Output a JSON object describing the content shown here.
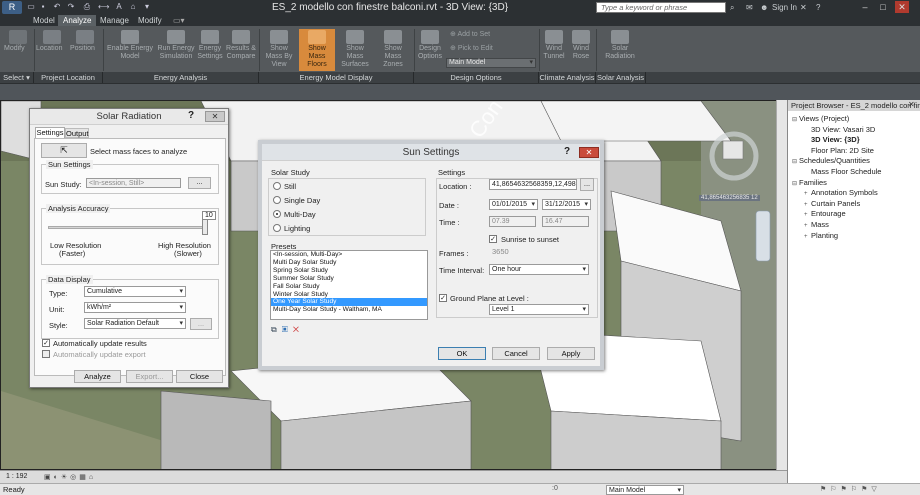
{
  "app": {
    "title": "ES_2 modello con finestre balconi.rvt - 3D View: {3D}",
    "search_placeholder": "Type a keyword or phrase",
    "sign_in": "Sign In",
    "app_button": "R"
  },
  "tabs": [
    "Model",
    "Analyze",
    "Manage",
    "Modify"
  ],
  "ribbon": {
    "buttons": [
      {
        "label": "Modify"
      },
      {
        "label": "Location"
      },
      {
        "label": "Position"
      },
      {
        "label": "Enable Energy Model"
      },
      {
        "label": "Run Energy Simulation"
      },
      {
        "label": "Energy Settings"
      },
      {
        "label": "Results & Compare"
      },
      {
        "label": "Show Mass By View"
      },
      {
        "label": "Show Mass Floors"
      },
      {
        "label": "Show Mass Surfaces"
      },
      {
        "label": "Show Mass Zones"
      },
      {
        "label": "Design Options"
      },
      {
        "label": "Wind Tunnel"
      },
      {
        "label": "Wind Rose"
      },
      {
        "label": "Solar Radiation"
      }
    ],
    "small": {
      "add_to_set": "Add to Set",
      "pick_to_edit": "Pick to Edit",
      "main_model": "Main Model"
    },
    "groups": [
      "Select ▾",
      "Project Location",
      "Energy Analysis",
      "Energy Model Display",
      "Design Options",
      "Climate Analysis",
      "Solar Analysis"
    ]
  },
  "solar_radiation": {
    "title": "Solar Radiation",
    "tabs": [
      "Settings",
      "Output"
    ],
    "select_text": "Select mass faces to analyze",
    "sun_settings": {
      "group": "Sun Settings",
      "label": "Sun Study:",
      "value": "<In-session, Still>",
      "browse": "..."
    },
    "accuracy": {
      "group": "Analysis Accuracy",
      "value": "10",
      "low": "Low Resolution",
      "low_sub": "(Faster)",
      "high": "High Resolution",
      "high_sub": "(Slower)",
      "fraction": 1.0
    },
    "display": {
      "group": "Data Display",
      "type_label": "Type:",
      "type_value": "Cumulative",
      "unit_label": "Unit:",
      "unit_value": "kWh/m²",
      "style_label": "Style:",
      "style_value": "Solar Radiation Default",
      "style_btn": "..."
    },
    "auto_update": "Automatically update results",
    "auto_export": "Automatically update export",
    "buttons": {
      "analyze": "Analyze",
      "export": "Export...",
      "close": "Close"
    }
  },
  "sun_settings": {
    "title": "Sun Settings",
    "solar_study": {
      "group": "Solar Study",
      "options": [
        "Still",
        "Single Day",
        "Multi-Day",
        "Lighting"
      ],
      "selected_index": 2
    },
    "presets": {
      "group": "Presets",
      "items": [
        "<In-session, Multi-Day>",
        "Multi Day Solar Study",
        "Spring Solar Study",
        "Summer Solar Study",
        "Fall Solar Study",
        "Winter Solar Study",
        "One Year Solar Study",
        "Multi-Day Solar Study - Waltham, MA"
      ],
      "selected_index": 6
    },
    "settings": {
      "group": "Settings",
      "location_label": "Location :",
      "location_value": "41,8654632568359,12,498342",
      "location_btn": "...",
      "date_label": "Date :",
      "date_from": "01/01/2015",
      "date_to": "31/12/2015",
      "time_label": "Time :",
      "time_from": "07.39",
      "time_to": "16.47",
      "sunrise_label": "Sunrise to sunset",
      "frames_label": "Frames :",
      "frames_value": "3650",
      "interval_label": "Time Interval:",
      "interval_value": "One hour",
      "ground_label": "Ground Plane at Level :",
      "ground_value": "Level 1"
    },
    "buttons": {
      "ok": "OK",
      "cancel": "Cancel",
      "apply": "Apply"
    }
  },
  "project_browser": {
    "title": "Project Browser - ES_2 modello con fin...",
    "items": [
      {
        "label": "Views (Project)",
        "level": 0,
        "exp": "⊟"
      },
      {
        "label": "3D View: Vasari 3D",
        "level": 1
      },
      {
        "label": "3D View: {3D}",
        "level": 1,
        "bold": true
      },
      {
        "label": "Floor Plan: 2D Site",
        "level": 1
      },
      {
        "label": "Schedules/Quantities",
        "level": 0,
        "exp": "⊟"
      },
      {
        "label": "Mass Floor Schedule",
        "level": 1
      },
      {
        "label": "Families",
        "level": 0,
        "exp": "⊟"
      },
      {
        "label": "Annotation Symbols",
        "level": 1,
        "exp": "+"
      },
      {
        "label": "Curtain Panels",
        "level": 1,
        "exp": "+"
      },
      {
        "label": "Entourage",
        "level": 1,
        "exp": "+"
      },
      {
        "label": "Mass",
        "level": 1,
        "exp": "+"
      },
      {
        "label": "Planting",
        "level": 1,
        "exp": "+"
      }
    ]
  },
  "viewport": {
    "scale": "1 : 192",
    "overlay_text": "Con",
    "coord_text": "41,865463256835 12"
  },
  "status": {
    "ready": "Ready",
    "model": "Main Model",
    "zero": ":0"
  }
}
